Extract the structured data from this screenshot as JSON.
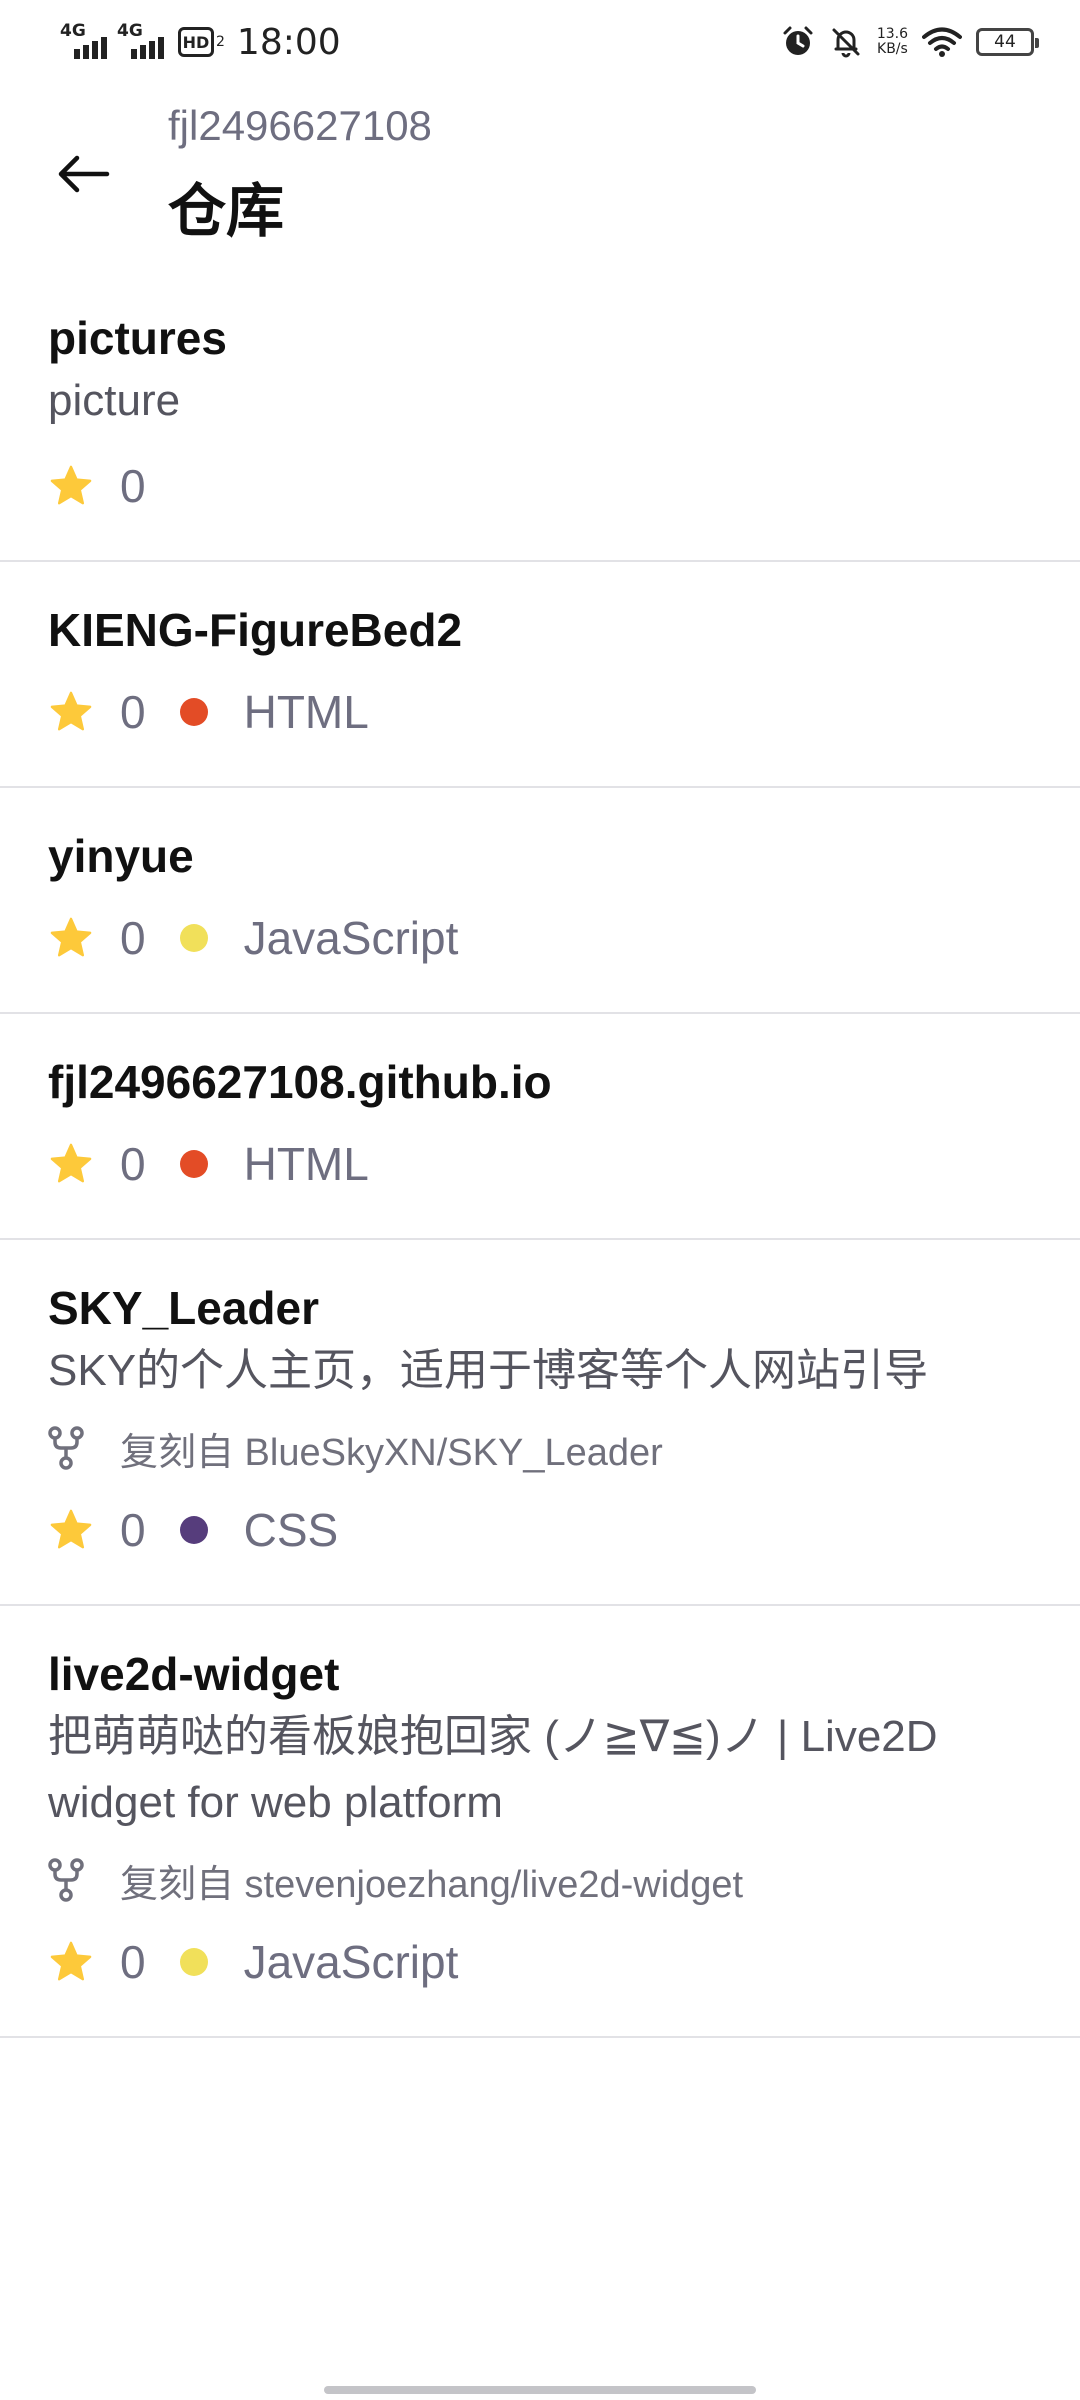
{
  "status_bar": {
    "signal1_label": "4G",
    "signal2_label": "4G",
    "hd_label": "HD",
    "hd_sub": "2",
    "time": "18:00",
    "net_speed_value": "13.6",
    "net_speed_unit": "KB/s",
    "battery": "44"
  },
  "header": {
    "owner": "fjl2496627108",
    "title": "仓库"
  },
  "colors": {
    "HTML": "#e34c26",
    "JavaScript": "#f1e05a",
    "CSS": "#563d7c",
    "star": "#fdc93a"
  },
  "repos": [
    {
      "name": "pictures",
      "description": "picture",
      "stars": "0"
    },
    {
      "name": "KIENG-FigureBed2",
      "stars": "0",
      "language": "HTML"
    },
    {
      "name": "yinyue",
      "stars": "0",
      "language": "JavaScript"
    },
    {
      "name": "fjl2496627108.github.io",
      "stars": "0",
      "language": "HTML"
    },
    {
      "name": "SKY_Leader",
      "description": "SKY的个人主页，适用于博客等个人网站引导",
      "fork": "复刻自 BlueSkyXN/SKY_Leader",
      "stars": "0",
      "language": "CSS"
    },
    {
      "name": "live2d-widget",
      "description": "把萌萌哒的看板娘抱回家 (ノ≧∇≦)ノ | Live2D widget for web platform",
      "fork": "复刻自 stevenjoezhang/live2d-widget",
      "stars": "0",
      "language": "JavaScript"
    }
  ]
}
